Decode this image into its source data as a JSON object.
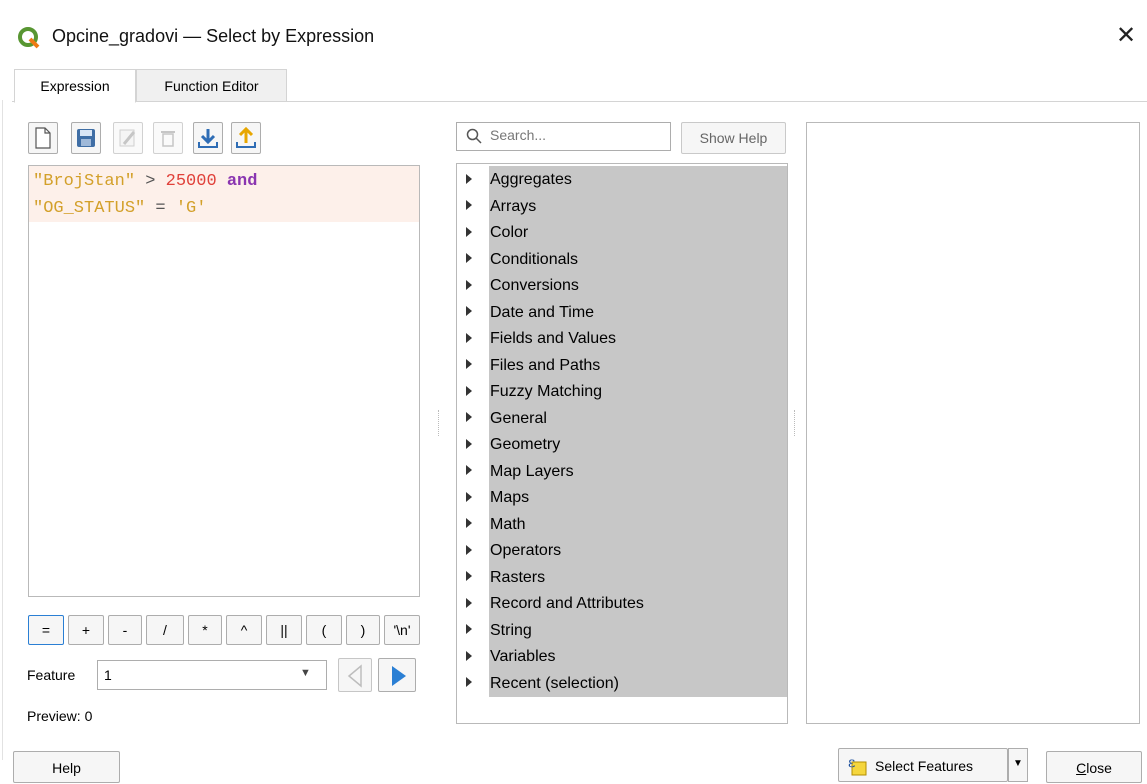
{
  "window": {
    "title": "Opcine_gradovi — Select by Expression",
    "close_label": "✕"
  },
  "tabs": [
    {
      "label": "Expression",
      "active": true
    },
    {
      "label": "Function Editor",
      "active": false
    }
  ],
  "toolbar": {
    "buttons": [
      {
        "name": "new-file-icon",
        "enabled": true
      },
      {
        "name": "save-icon",
        "enabled": true
      },
      {
        "name": "edit-icon",
        "enabled": false
      },
      {
        "name": "delete-icon",
        "enabled": false
      },
      {
        "name": "import-icon",
        "enabled": true
      },
      {
        "name": "export-icon",
        "enabled": true
      }
    ]
  },
  "editor": {
    "line1": {
      "field": "\"BrojStan\"",
      "op": " > ",
      "num": "25000",
      "kw": " and"
    },
    "line2": {
      "field": "\"OG_STATUS\"",
      "op": " = ",
      "str": "'G'"
    }
  },
  "operators": [
    "=",
    "+",
    "-",
    "/",
    "*",
    "^",
    "||",
    "(",
    ")",
    "'\\n'"
  ],
  "feature": {
    "label": "Feature",
    "value": "1"
  },
  "preview": {
    "label": "Preview:",
    "value": "0",
    "text": "Preview: 0"
  },
  "search": {
    "placeholder": "Search..."
  },
  "show_help_label": "Show Help",
  "function_groups": [
    "Aggregates",
    "Arrays",
    "Color",
    "Conditionals",
    "Conversions",
    "Date and Time",
    "Fields and Values",
    "Files and Paths",
    "Fuzzy Matching",
    "General",
    "Geometry",
    "Map Layers",
    "Maps",
    "Math",
    "Operators",
    "Rasters",
    "Record and Attributes",
    "String",
    "Variables",
    "Recent (selection)"
  ],
  "buttons": {
    "help": "Help",
    "select_features": "Select Features",
    "close_prefix": "C",
    "close_rest": "lose"
  },
  "colors": {
    "string": "#d3a02a",
    "number": "#e0413a",
    "keyword": "#8a35b0",
    "selection": "#c7c7c7",
    "accent_blue": "#2a7fd4"
  }
}
